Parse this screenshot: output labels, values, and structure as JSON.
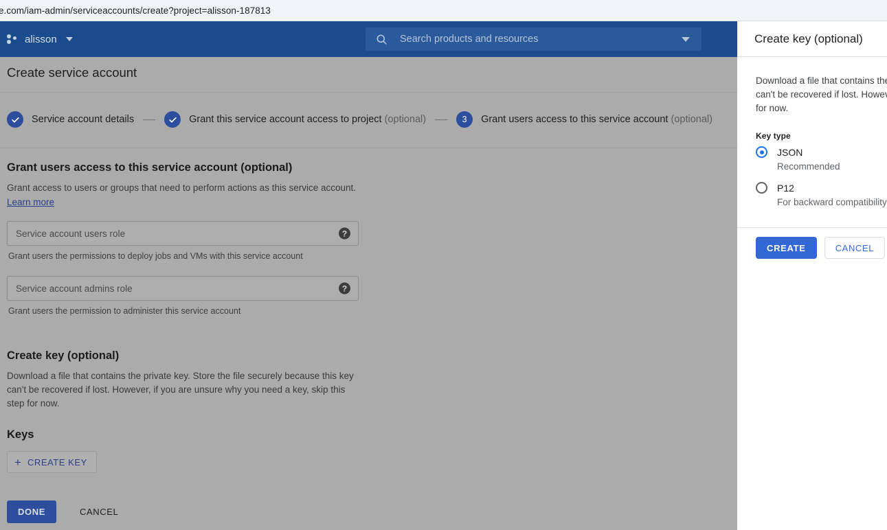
{
  "browser": {
    "url": "e.com/iam-admin/serviceaccounts/create?project=alisson-187813"
  },
  "appbar": {
    "project_name": "alisson",
    "project_icon": "cloud-project-dots-icon",
    "dropdown_icon": "chevron-down-icon",
    "search": {
      "placeholder": "Search products and resources",
      "search_icon": "search-icon",
      "dropdown_icon": "chevron-down-icon"
    },
    "background_color": "#1a4b8c"
  },
  "page": {
    "title": "Create service account",
    "background_color": "#ababab",
    "stepper": [
      {
        "state": "done",
        "marker": "✓",
        "label": "Service account details",
        "optional": ""
      },
      {
        "state": "done",
        "marker": "✓",
        "label": "Grant this service account access to project",
        "optional": " (optional)"
      },
      {
        "state": "active",
        "marker": "3",
        "label": "Grant users access to this service account",
        "optional": " (optional)"
      }
    ]
  },
  "form": {
    "grant_users": {
      "heading": "Grant users access to this service account (optional)",
      "description": "Grant access to users or groups that need to perform actions as this service account.",
      "learn_more": "Learn more",
      "fields": [
        {
          "label": "Service account users role",
          "hint": "Grant users the permissions to deploy jobs and VMs with this service account",
          "help_icon": "help-circle-icon"
        },
        {
          "label": "Service account admins role",
          "hint": "Grant users the permission to administer this service account",
          "help_icon": "help-circle-icon"
        }
      ]
    },
    "create_key": {
      "heading": "Create key (optional)",
      "description": "Download a file that contains the private key. Store the file securely because this key can't be recovered if lost. However, if you are unsure why you need a key, skip this step for now.",
      "keys_heading": "Keys",
      "create_key_button": "CREATE KEY",
      "plus_icon": "plus-icon"
    },
    "actions": {
      "done": "DONE",
      "cancel": "CANCEL"
    }
  },
  "panel": {
    "title": "Create key (optional)",
    "description_line1": "Download a file that contains the",
    "description_line2": "can't be recovered if lost. Howeve",
    "description_line3": "for now.",
    "key_type_label": "Key type",
    "options": [
      {
        "label": "JSON",
        "desc": "Recommended",
        "selected": true
      },
      {
        "label": "P12",
        "desc": "For backward compatibility with",
        "selected": false
      }
    ],
    "create_button": "CREATE",
    "cancel_button": "CANCEL",
    "accent_color": "#1a73e8",
    "create_button_color": "#3367d6"
  }
}
